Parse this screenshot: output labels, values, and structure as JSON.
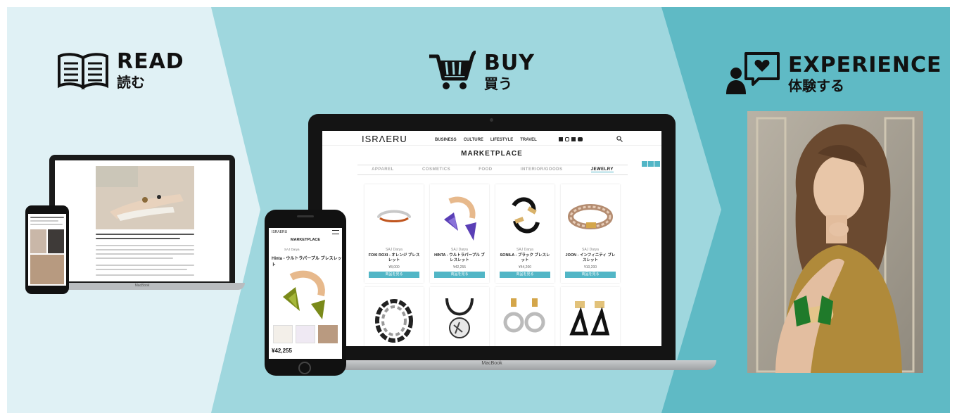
{
  "sections": {
    "read": {
      "title": "READ",
      "subtitle": "読む",
      "icon": "open-book-icon"
    },
    "buy": {
      "title": "BUY",
      "subtitle": "買う",
      "icon": "shopping-cart-icon"
    },
    "experience": {
      "title": "EXPERIENCE",
      "subtitle": "体験する",
      "icon": "person-heart-speech-icon"
    }
  },
  "colors": {
    "panel_left": "#e0f1f5",
    "panel_mid": "#9fd7de",
    "panel_right": "#5fbac5",
    "accent": "#52b6c6"
  },
  "macbook": {
    "label": "MacBook"
  },
  "site": {
    "logo": "ISRΛERU",
    "nav": [
      "BUSINESS",
      "CULTURE",
      "LIFESTYLE",
      "TRAVEL"
    ],
    "social_icons": [
      "facebook-icon",
      "instagram-icon",
      "twitter-icon",
      "youtube-icon"
    ],
    "page_title": "MARKETPLACE",
    "tabs": [
      "APPAREL",
      "COSMETICS",
      "FOOD",
      "INTERIOR/GOODS",
      "JEWELRY"
    ],
    "active_tab": "JEWELRY",
    "products": [
      {
        "brand": "SAJ Darya",
        "name": "FOXI ROXI - オレンジ ブレスレット",
        "price": "¥8,000",
        "button": "商品を見る"
      },
      {
        "brand": "SAJ Darya",
        "name": "HINTA - ウルトラパープル ブレスレット",
        "price": "¥42,255",
        "button": "商品を見る"
      },
      {
        "brand": "SAJ Darya",
        "name": "SONILA - ブラック ブレスレット",
        "price": "¥44,200",
        "button": "商品を見る"
      },
      {
        "brand": "SAJ Darya",
        "name": "JOON - インフィニティ ブレスレット",
        "price": "¥10,200",
        "button": "商品を見る"
      }
    ]
  },
  "phone_center": {
    "logo": "ISRΛERU",
    "page_title": "MARKETPLACE",
    "brand": "SAJ Darya",
    "product_name": "Hinta - ウルトラパープル ブレスレット",
    "price": "¥42,255"
  }
}
